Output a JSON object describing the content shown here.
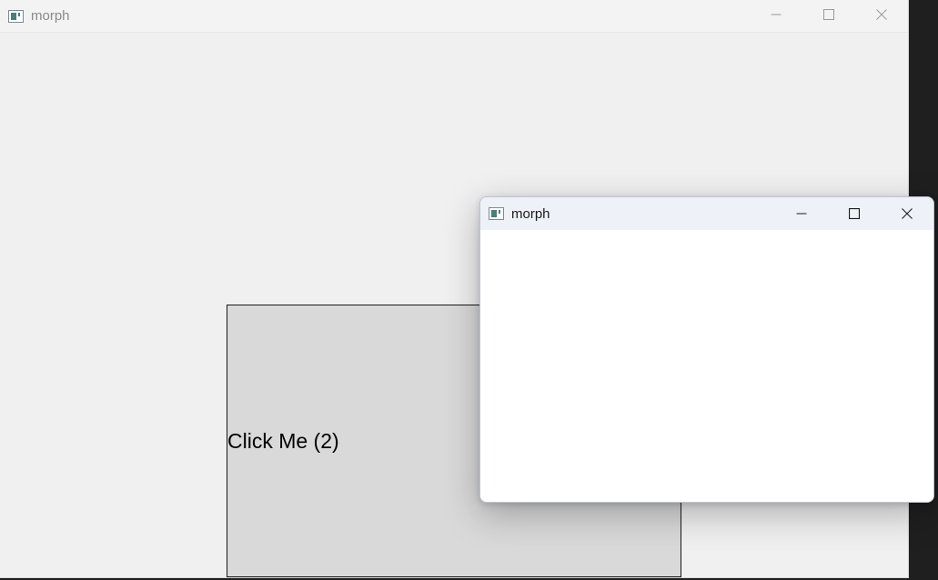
{
  "main_window": {
    "title": "morph",
    "icon": "app-window-icon",
    "caption": {
      "minimize_icon": "minimize-icon",
      "maximize_icon": "maximize-icon",
      "close_icon": "close-icon"
    },
    "button_label": "Click Me (2)"
  },
  "dialog_window": {
    "title": "morph",
    "icon": "app-window-icon",
    "caption": {
      "minimize_icon": "minimize-icon",
      "maximize_icon": "maximize-icon",
      "close_icon": "close-icon"
    }
  },
  "colors": {
    "window_background": "#f0f0f0",
    "button_background": "#d9d9d9",
    "dialog_titlebar": "#eef1f8",
    "inactive_title_text": "#8a8a8a"
  }
}
